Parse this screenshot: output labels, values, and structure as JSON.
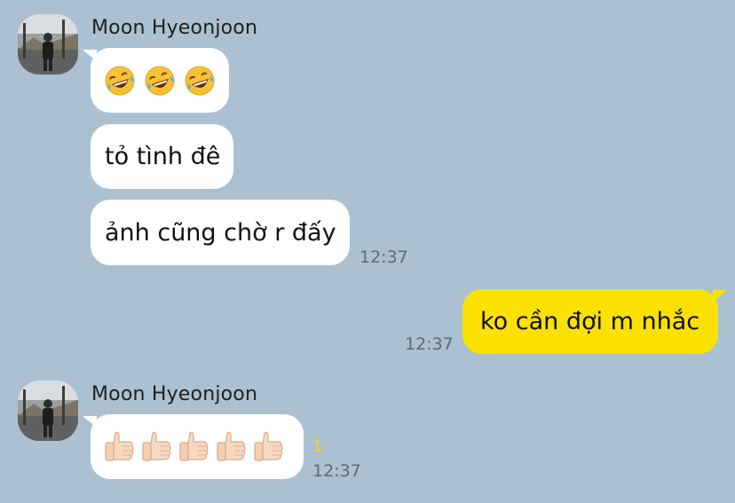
{
  "chat": {
    "messages": [
      {
        "sender": "Moon Hyeonjoon",
        "items": [
          {
            "kind": "emoji",
            "emoji_name": "rolling-on-the-floor-laughing",
            "count": 3
          },
          {
            "kind": "text",
            "text": "tỏ tình đê"
          },
          {
            "kind": "text",
            "text": "ảnh cũng chờ r đấy",
            "time": "12:37"
          }
        ]
      },
      {
        "sender": "me",
        "items": [
          {
            "kind": "text",
            "text": "ko cần đợi m nhắc",
            "time": "12:37"
          }
        ]
      },
      {
        "sender": "Moon Hyeonjoon",
        "items": [
          {
            "kind": "emoji",
            "emoji_name": "thumbs-up-light-skin",
            "count": 5,
            "unread": "1",
            "time": "12:37"
          }
        ]
      }
    ]
  },
  "colors": {
    "background": "#abc1d1",
    "my_bubble": "#fae100",
    "their_bubble": "#ffffff",
    "unread": "#f5d50c"
  }
}
